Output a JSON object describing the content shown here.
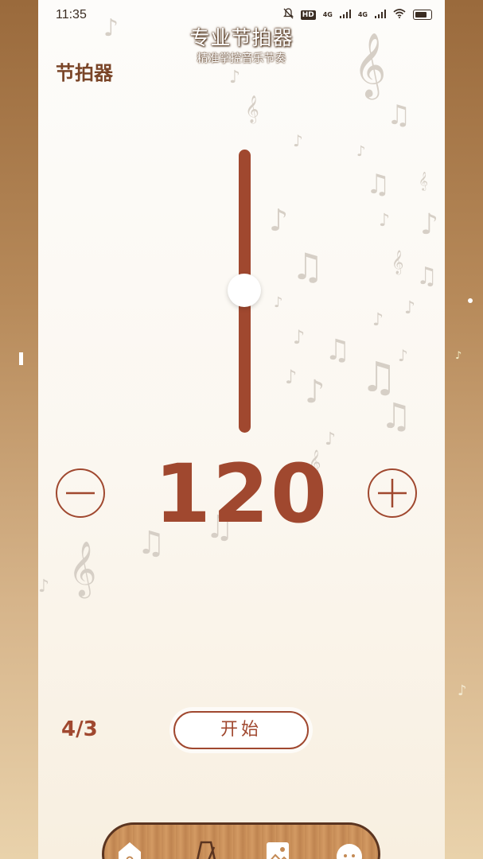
{
  "status_bar": {
    "time": "11:35",
    "hd_label": "HD",
    "net1": "4G",
    "net2": "4G"
  },
  "banner": {
    "title": "专业节拍器",
    "subtitle": "精准掌控音乐节奏"
  },
  "header": {
    "title": "节拍器"
  },
  "tempo": {
    "bpm": "120",
    "slider_level": 0.55
  },
  "controls": {
    "time_signature": "4/3",
    "start_label": "开始"
  },
  "bottom_nav": {
    "items": [
      {
        "icon": "home-icon"
      },
      {
        "icon": "metronome-icon"
      },
      {
        "icon": "gallery-icon"
      },
      {
        "icon": "chat-icon"
      }
    ]
  },
  "colors": {
    "accent": "#a0482f",
    "title_brown": "#7a4528",
    "wood": "#c48a55"
  }
}
